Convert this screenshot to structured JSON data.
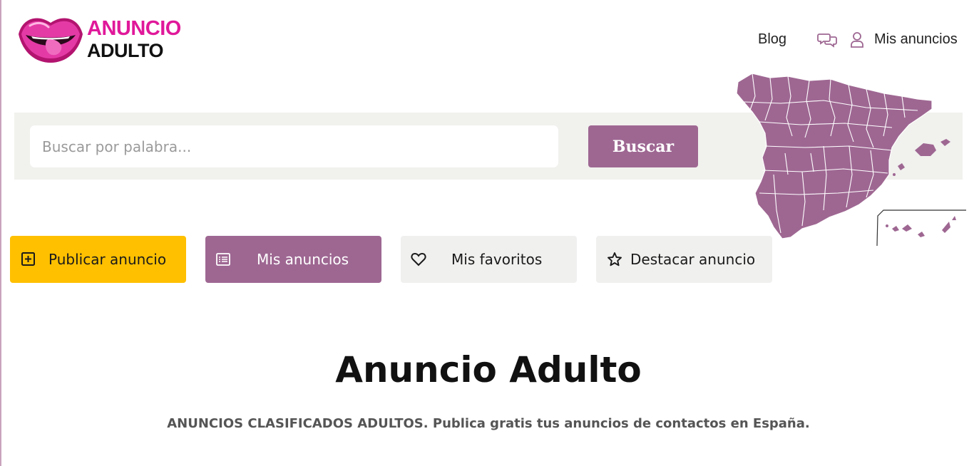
{
  "logo": {
    "line1": "ANUNCIO",
    "line2": "ADULTO",
    "icon": "lips-icon"
  },
  "nav": {
    "blog": "Blog",
    "chat_icon": "chat-bubbles-icon",
    "user_icon": "user-icon",
    "mis_anuncios": "Mis anuncios"
  },
  "search": {
    "placeholder": "Buscar por palabra...",
    "value": "",
    "button": "Buscar"
  },
  "map": {
    "icon": "spain-map"
  },
  "actions": [
    {
      "label": "Publicar anuncio",
      "icon": "plus-square-icon"
    },
    {
      "label": "Mis anuncios",
      "icon": "list-icon"
    },
    {
      "label": "Mis favoritos",
      "icon": "heart-icon"
    },
    {
      "label": "Destacar anuncio",
      "icon": "star-icon"
    }
  ],
  "hero": {
    "title": "Anuncio Adulto",
    "subtitle": "ANUNCIOS CLASIFICADOS ADULTOS. Publica gratis tus anuncios de contactos en España."
  },
  "colors": {
    "brand_pink": "#e0199a",
    "purple": "#9e6792",
    "yellow": "#ffc000",
    "light_gray": "#f0f0ef"
  }
}
